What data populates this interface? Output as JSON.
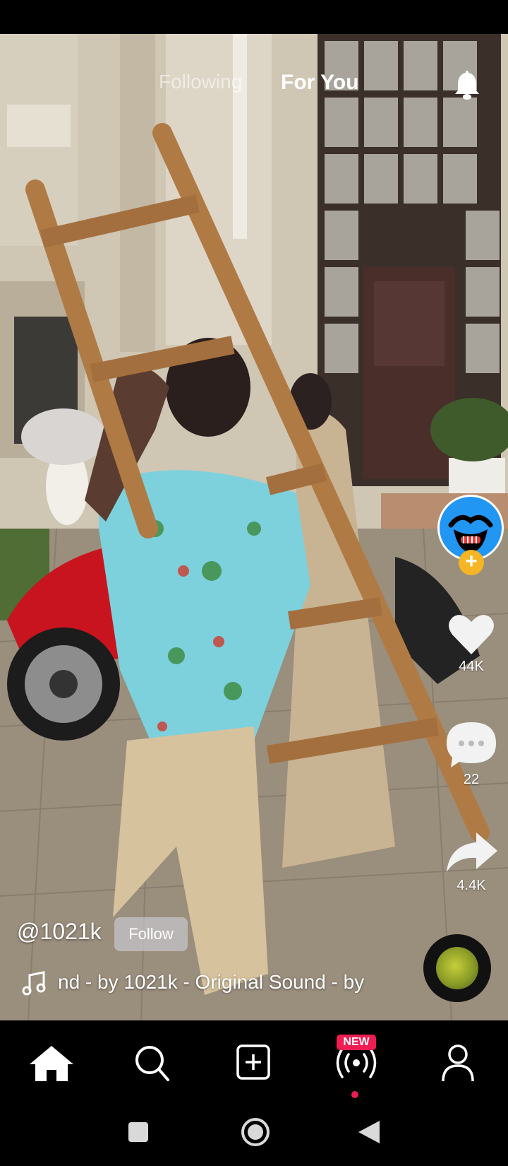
{
  "top_tabs": {
    "following": "Following",
    "for_you": "For You"
  },
  "icons": {
    "bell": "bell-icon",
    "like": "heart-icon",
    "comment": "comment-icon",
    "share": "share-icon",
    "music": "music-note-icon"
  },
  "creator": {
    "handle": "@1021k",
    "follow_label": "Follow",
    "plus": "+"
  },
  "engagement": {
    "likes": "44K",
    "comments": "22",
    "shares": "4.4K"
  },
  "sound": {
    "text": "nd - by 1021k - Original Sound - by"
  },
  "bottom_nav": {
    "items": [
      "home-icon",
      "search-icon",
      "create-icon",
      "live-icon",
      "profile-icon"
    ],
    "new_badge": "NEW"
  },
  "colors": {
    "accent": "#ee1d52",
    "avatar": "#2196f3",
    "plus_badge": "#f5b524"
  }
}
